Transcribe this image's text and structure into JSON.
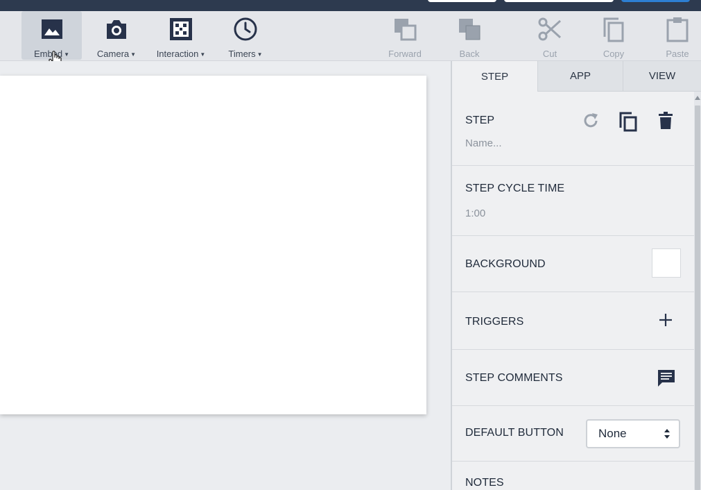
{
  "toolbar": {
    "left_stub": "-",
    "items": [
      {
        "label": "Embed",
        "icon": "image-icon",
        "active": true
      },
      {
        "label": "Camera",
        "icon": "camera-icon"
      },
      {
        "label": "Interaction",
        "icon": "qr-code-icon"
      },
      {
        "label": "Timers",
        "icon": "clock-icon"
      }
    ],
    "actions": [
      {
        "label": "Forward",
        "icon": "bring-forward-icon"
      },
      {
        "label": "Back",
        "icon": "send-back-icon"
      },
      {
        "label": "Cut",
        "icon": "scissors-icon"
      },
      {
        "label": "Copy",
        "icon": "copy-icon"
      },
      {
        "label": "Paste",
        "icon": "clipboard-icon"
      }
    ]
  },
  "panel": {
    "tabs": [
      "STEP",
      "APP",
      "VIEW"
    ],
    "active_tab": "STEP",
    "step": {
      "title": "STEP",
      "placeholder": "Name..."
    },
    "cycle_time": {
      "title": "STEP CYCLE TIME",
      "value": "1:00"
    },
    "background": {
      "title": "BACKGROUND",
      "color": "#ffffff"
    },
    "triggers": {
      "title": "TRIGGERS"
    },
    "comments": {
      "title": "STEP COMMENTS"
    },
    "default_button": {
      "title": "DEFAULT BUTTON",
      "value": "None"
    },
    "notes": {
      "title": "NOTES"
    }
  },
  "colors": {
    "topbar": "#2d3a4f",
    "accent": "#2d7fd3",
    "icon_dark": "#27324a",
    "icon_disabled": "#9aa2ad"
  }
}
